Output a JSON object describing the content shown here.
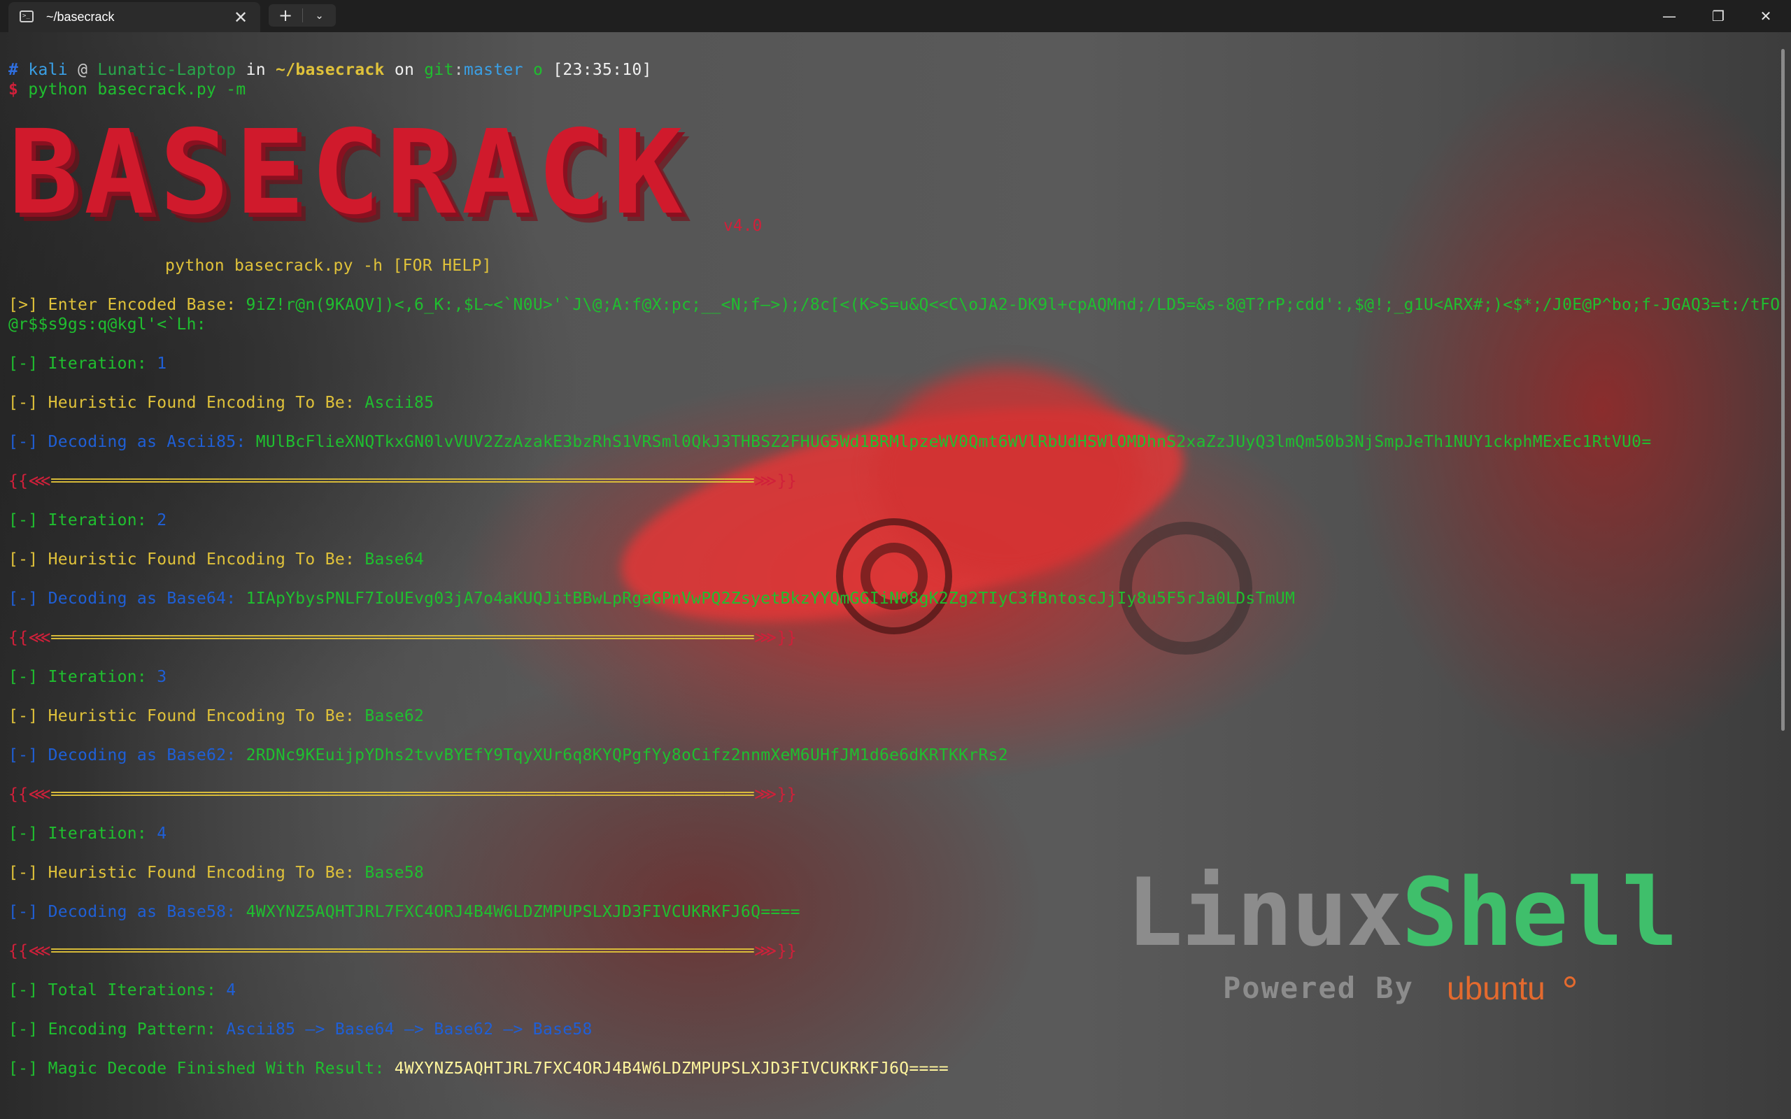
{
  "window": {
    "tab_title": "~/basecrack",
    "tab_icon": "terminal-icon",
    "close_tab": "✕",
    "new_tab": "+",
    "dropdown": "⌄",
    "minimize": "—",
    "restore": "❐",
    "close": "✕"
  },
  "prompt": {
    "hash": "#",
    "user": "kali",
    "at": "@",
    "host": "Lunatic-Laptop",
    "in": "in",
    "path": "~/basecrack",
    "on": "on",
    "git": "git",
    "colon": ":",
    "branch": "master",
    "status": "o",
    "time": "[23:35:10]",
    "dollar": "$",
    "command": "python basecrack.py -m"
  },
  "banner": {
    "logo_text": "BASECRACK",
    "version": "v4.0",
    "help": "python basecrack.py -h [FOR HELP]"
  },
  "output": {
    "enter_prefix": "[>] Enter Encoded Base:",
    "encoded_line1": "9iZ!r@n(9KAQV])<,6_K:,$L~<`N0U>'`J\\@;A:f@X:pc;__<N;f—>);/8c[<(K>S=u&Q<<C\\oJA2-DK9l+cpAQMnd;/LD5=&s-8@T?rP;cdd':,$@!;_g1U<ARX#;)<$*;/J0E@P^bo;f-JGAQ3=t:/tFO",
    "encoded_line2": "@r$$s9gs:q@kgl'<`Lh:",
    "iterations": [
      {
        "iter_label": "[-] Iteration:",
        "iter_num": "1",
        "heur_label": "[-] Heuristic Found Encoding To Be:",
        "heur_value": "Ascii85",
        "dec_prefix": "[-]",
        "dec_label": "Decoding as Ascii85:",
        "dec_value": "MUlBcFlieXNQTkxGN0lvVUV2ZzAzakE3bzRhS1VRSml0QkJ3THBSZ2FHUG5Wd1BRMlpzeWV0Qmt6WVlRbUdHSWlOMDhnS2xaZzJUyQ3lmQm50b3NjSmpJeTh1NUY1ckphMExEc1RtVU0=",
        "sep": "{{⋘═══════════════════════════════════════════════════════════════════════⋙}}"
      },
      {
        "iter_label": "[-] Iteration:",
        "iter_num": "2",
        "heur_label": "[-] Heuristic Found Encoding To Be:",
        "heur_value": "Base64",
        "dec_prefix": "[-]",
        "dec_label": "Decoding as Base64:",
        "dec_value": "1IApYbysPNLF7IoUEvg03jA7o4aKUQJitBBwLpRgaGPnVwPQ2ZsyetBkzYYQmGGIiN08gK2Zg2TIyC3fBntoscJjIy8u5F5rJa0LDsTmUM",
        "sep": "{{⋘═══════════════════════════════════════════════════════════════════════⋙}}"
      },
      {
        "iter_label": "[-] Iteration:",
        "iter_num": "3",
        "heur_label": "[-] Heuristic Found Encoding To Be:",
        "heur_value": "Base62",
        "dec_prefix": "[-]",
        "dec_label": "Decoding as Base62:",
        "dec_value": "2RDNc9KEuijpYDhs2tvvBYEfY9TqyXUr6q8KYQPgfYy8oCifz2nnmXeM6UHfJM1d6e6dKRTKKrRs2",
        "sep": "{{⋘═══════════════════════════════════════════════════════════════════════⋙}}"
      },
      {
        "iter_label": "[-] Iteration:",
        "iter_num": "4",
        "heur_label": "[-] Heuristic Found Encoding To Be:",
        "heur_value": "Base58",
        "dec_prefix": "[-]",
        "dec_label": "Decoding as Base58:",
        "dec_value": "4WXYNZ5AQHTJRL7FXC4ORJ4B4W6LDZMPUPSLXJD3FIVCUKRKFJ6Q====",
        "sep": "{{⋘═══════════════════════════════════════════════════════════════════════⋙}}"
      }
    ],
    "total_label": "[-] Total Iterations:",
    "total_value": "4",
    "pattern_label": "[-] Encoding Pattern:",
    "pattern_value": "Ascii85 —> Base64 —> Base62 —> Base58",
    "finish_label": "[-] Magic Decode Finished With Result:",
    "finish_value": "4WXYNZ5AQHTJRL7FXC4ORJ4B4W6LDZMPUPSLXJD3FIVCUKRKFJ6Q===="
  },
  "wallpaper": {
    "logo_linux": "Linux",
    "logo_shell": "Shell",
    "powered_by": "Powered By",
    "ubuntu": "ubuntu"
  },
  "colors": {
    "titlebar": "#1f1f1f",
    "accent_red": "#d01a2c",
    "green": "#1fbf2f",
    "blue": "#2f6fe0",
    "yellow": "#e0c23a"
  }
}
